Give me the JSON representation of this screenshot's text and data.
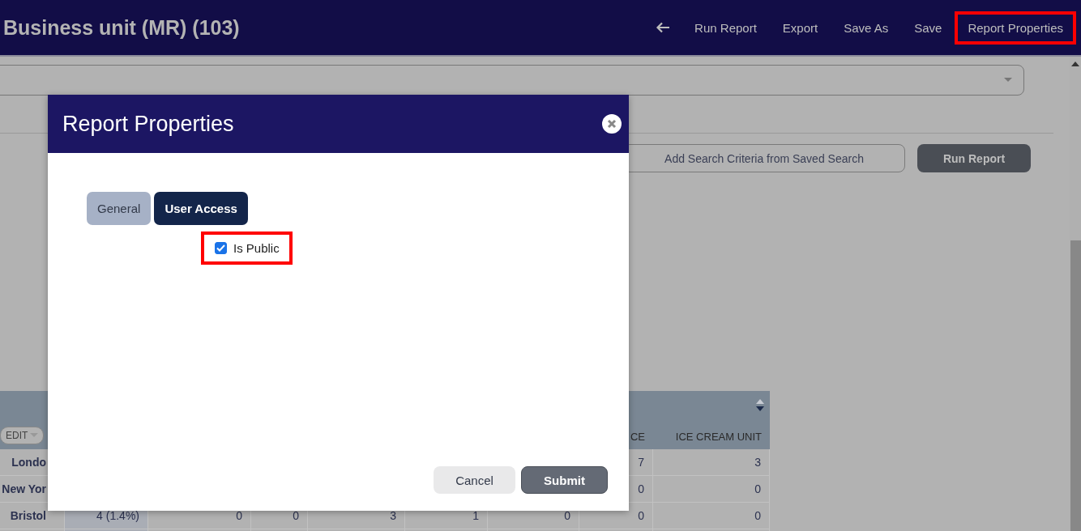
{
  "top_bar": {
    "title": "Business unit (MR) (103)",
    "actions": [
      {
        "label": "Run Report",
        "highlighted": false
      },
      {
        "label": "Export",
        "highlighted": false
      },
      {
        "label": "Save As",
        "highlighted": false
      },
      {
        "label": "Save",
        "highlighted": false
      },
      {
        "label": "Report Properties",
        "highlighted": true
      }
    ]
  },
  "search_buttons": [
    {
      "label": "Add Search Criteria from Saved Search",
      "kind": "outline"
    },
    {
      "label": "Run Report",
      "kind": "primary"
    }
  ],
  "table": {
    "edit_button": "EDIT",
    "columns": [
      null,
      null,
      null,
      null,
      null,
      null,
      null,
      "CE",
      "ICE CREAM UNIT"
    ],
    "rows": [
      {
        "cells": [
          "Londo",
          null,
          null,
          null,
          null,
          null,
          null,
          "7",
          "3"
        ]
      },
      {
        "cells": [
          "New Yor",
          null,
          null,
          null,
          null,
          null,
          null,
          "0",
          "0"
        ]
      },
      {
        "cells": [
          "Bristol",
          "4 (1.4%)",
          "0",
          "0",
          "3",
          "1",
          "0",
          "0",
          "0"
        ]
      },
      {
        "cells": [
          null,
          null,
          null,
          null,
          null,
          null,
          null,
          null,
          null
        ]
      }
    ]
  },
  "dialog": {
    "title": "Report Properties",
    "tabs": [
      {
        "label": "General",
        "selected": false
      },
      {
        "label": "User Access",
        "selected": true
      }
    ],
    "checkbox": {
      "label": "Is Public",
      "checked": true,
      "highlighted": true
    },
    "buttons": [
      {
        "label": "Cancel",
        "kind": "secondary"
      },
      {
        "label": "Submit",
        "kind": "primary"
      }
    ]
  }
}
